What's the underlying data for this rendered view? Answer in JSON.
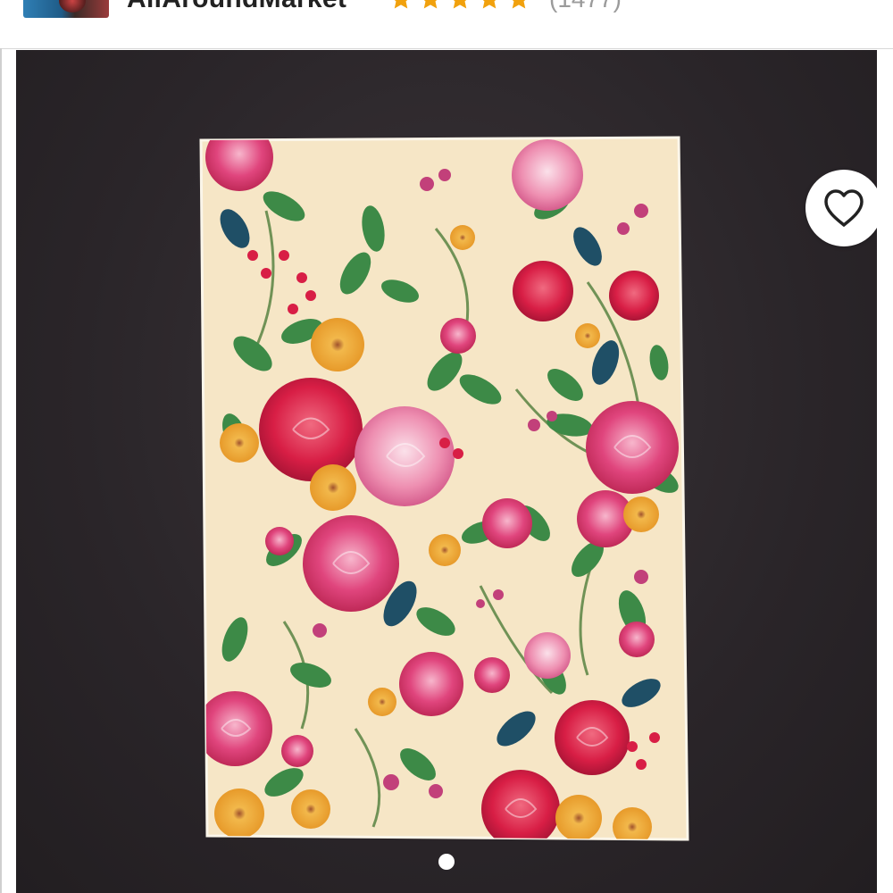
{
  "shop": {
    "name": "AllAroundMarket",
    "rating_stars": 5,
    "rating_max": 5,
    "review_count": "(1477)"
  },
  "product_image": {
    "subject": "floral print paper sheet on dark background",
    "active_slide": 1,
    "total_slides": 1
  },
  "icons": {
    "favorite": "heart-outline-icon",
    "rating_star": "star-icon"
  },
  "colors": {
    "star": "#f1a10d",
    "photo_background": "#2a2529",
    "paper": "#f6e6c6",
    "rose_pink": "#e0457d",
    "leaf_green": "#3d8a47"
  }
}
